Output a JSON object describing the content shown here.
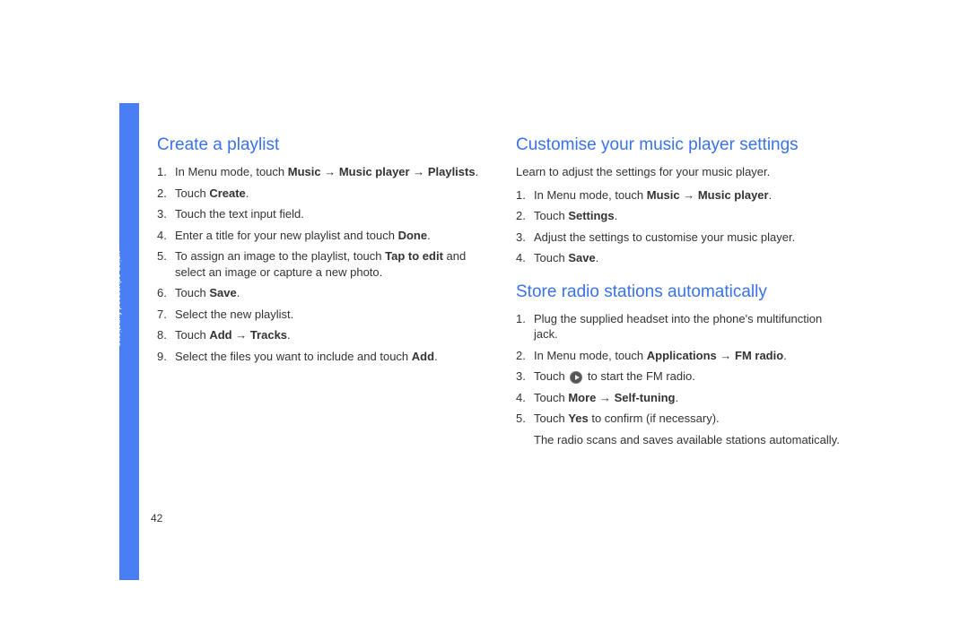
{
  "sidebar_label": "using advanced functions",
  "page_number": "42",
  "left": {
    "h1": "Create a playlist",
    "steps": [
      {
        "pre": "In Menu mode, touch ",
        "b1": "Music",
        "mid1": " → ",
        "b2": "Music player",
        "mid2": " → ",
        "b3": "Playlists",
        "post": "."
      },
      {
        "pre": "Touch ",
        "b1": "Create",
        "post": "."
      },
      {
        "pre": "Touch the text input field."
      },
      {
        "pre": "Enter a title for your new playlist and touch ",
        "b1": "Done",
        "post": "."
      },
      {
        "pre": "To assign an image to the playlist, touch ",
        "b1": "Tap to edit",
        "post": " and select an image or capture a new photo."
      },
      {
        "pre": "Touch ",
        "b1": "Save",
        "post": "."
      },
      {
        "pre": "Select the new playlist."
      },
      {
        "pre": "Touch ",
        "b1": "Add",
        "mid1": " → ",
        "b2": "Tracks",
        "post": "."
      },
      {
        "pre": "Select the files you want to include and touch ",
        "b1": "Add",
        "post": "."
      }
    ]
  },
  "right": {
    "s1": {
      "h": "Customise your music player settings",
      "intro": "Learn to adjust the settings for your music player.",
      "steps": [
        {
          "pre": "In Menu mode, touch ",
          "b1": "Music",
          "mid1": " → ",
          "b2": "Music player",
          "post": "."
        },
        {
          "pre": "Touch ",
          "b1": "Settings",
          "post": "."
        },
        {
          "pre": "Adjust the settings to customise your music player."
        },
        {
          "pre": "Touch ",
          "b1": "Save",
          "post": "."
        }
      ]
    },
    "s2": {
      "h": "Store radio stations automatically",
      "steps": [
        {
          "pre": "Plug the supplied headset into the phone's multifunction jack."
        },
        {
          "pre": "In Menu mode, touch ",
          "b1": "Applications",
          "mid1": " → ",
          "b2": "FM radio",
          "post": "."
        },
        {
          "pre": "Touch ",
          "icon": true,
          "post": " to start the FM radio."
        },
        {
          "pre": "Touch ",
          "b1": "More",
          "mid1": " → ",
          "b2": "Self-tuning",
          "post": "."
        },
        {
          "pre": "Touch ",
          "b1": "Yes",
          "post": " to confirm (if necessary)."
        }
      ],
      "note": "The radio scans and saves available stations automatically."
    }
  }
}
